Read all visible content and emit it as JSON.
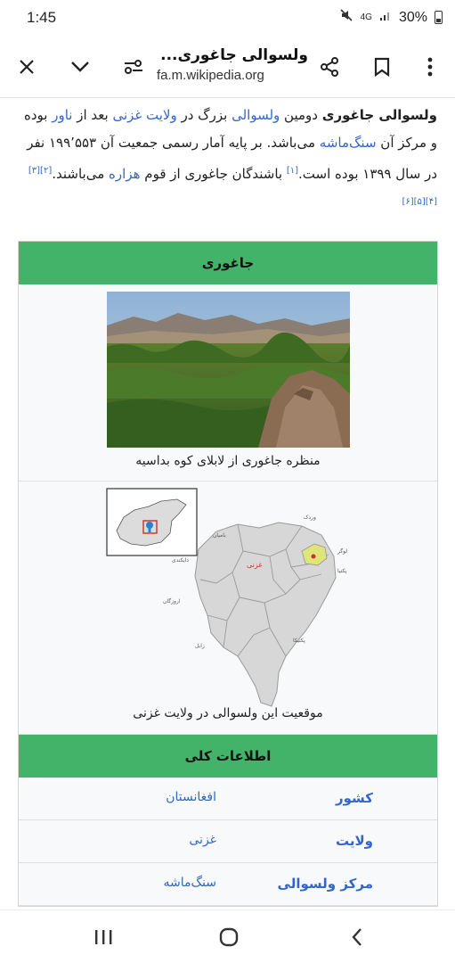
{
  "status_bar": {
    "time": "1:45",
    "network": "4G",
    "battery": "30%"
  },
  "toolbar": {
    "title": "ولسوالی جاغوری...",
    "url": "fa.m.wikipedia.org",
    "icons": [
      "close-icon",
      "chevron-down-icon",
      "page-settings-icon",
      "share-icon",
      "bookmark-icon",
      "more-vert-icon"
    ]
  },
  "article": {
    "bold_name": "ولسوالی جاغوری",
    "t1": " دومین ",
    "link_wolswali": "ولسوالی",
    "t2": " بزرگ در ",
    "link_ghazni": "ولایت غزنی",
    "t3": " بعد از ",
    "link_nawur": "ناور",
    "t4": " بوده و مرکز آن ",
    "link_sangmasha": "سنگ‌ماشه",
    "t5": " می‌باشد. بر پایه آمار رسمی جمعیت آن ۱۹۹٬۵۵۳ نفر در سال ۱۳۹۹ بوده است.",
    "ref1": "[۱]",
    "t6": " باشندگان جاغوری از قوم ",
    "link_hazara": "هزاره",
    "t7": " می‌باشند.",
    "refs": "[۲][۳][۴][۵][۶]"
  },
  "infobox": {
    "header": "جاغوری",
    "photo_caption": "منظره جاغوری از لابلای کوه بداسیه",
    "map_caption": "موقعیت این ولسوالی در ولایت غزنی",
    "map_labels": {
      "ghazni": "غزنی",
      "wardak": "وردک",
      "bamyan": "بامیان",
      "daykundi": "دایکندی",
      "urozgan": "اروزگان",
      "zabul": "زابل",
      "paktika": "پکتیکا",
      "logar": "لوگر",
      "paktia": "پکتیا"
    },
    "section_title": "اطلاعات کلی",
    "rows": [
      {
        "label": "کشور",
        "value": "افغانستان"
      },
      {
        "label": "ولایت",
        "value": "غزنی"
      },
      {
        "label": "مرکز ولسوالی",
        "value": "سنگ‌ماشه"
      }
    ]
  },
  "colors": {
    "accent_green": "#43b36a",
    "link_blue": "#3366cc",
    "map_highlight": "#e0e57a"
  }
}
